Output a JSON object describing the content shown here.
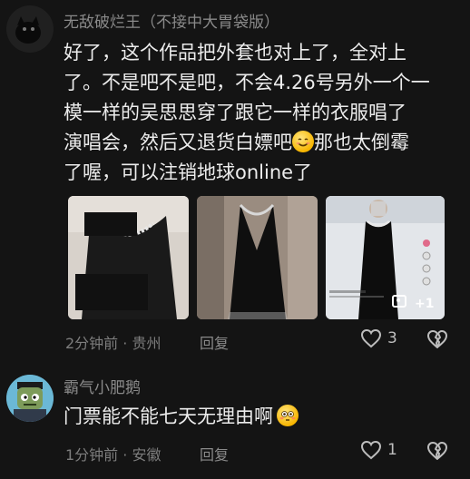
{
  "comments": [
    {
      "username": "无敌破烂王（不接中大胃袋版）",
      "lines": [
        "好了，这个作品把外套也对上了，全对上",
        "了。不是吧不是吧，不会4.26号另外一个一",
        "模一样的吴思思穿了跟它一样的衣服唱了",
        "演唱会，然后又退货白嫖吧",
        "了喔，可以注销地球online了"
      ],
      "line4_suffix": "那也太倒霉",
      "emoji": "smiling-face-icon",
      "time_location": "2分钟前 · 贵州",
      "reply_label": "回复",
      "like_count": "3",
      "thumb_overlay_count": "+1"
    },
    {
      "username": "霸气小肥鹅",
      "text": "门票能不能七天无理由啊",
      "emoji": "flushed-face-icon",
      "time_location": "1分钟前 · 安徽",
      "reply_label": "回复",
      "like_count": "1"
    }
  ],
  "colors": {
    "background": "#141414",
    "username": "#8a8a8a",
    "text": "#ececec",
    "meta": "#7d7d7d"
  }
}
